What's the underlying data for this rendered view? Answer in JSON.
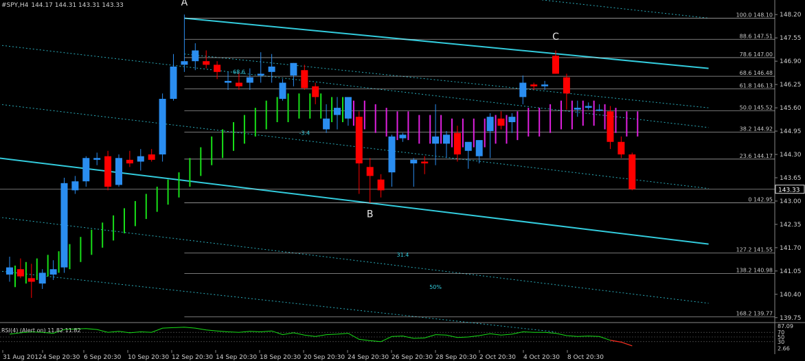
{
  "chart_data": {
    "type": "candlestick",
    "symbol_header": "#SPY,H4",
    "ohlc_header": "144.17 144.31 143.31 143.33",
    "price_axis": {
      "range": [
        139.65,
        148.3
      ],
      "ticks": [
        "148.20",
        "147.55",
        "146.90",
        "146.25",
        "145.60",
        "144.95",
        "144.30",
        "143.65",
        "143.00",
        "142.35",
        "141.70",
        "141.05",
        "140.40",
        "139.75"
      ],
      "current_price_label": "143.33",
      "current_price": 143.33
    },
    "time_axis": {
      "labels": [
        "31 Aug 2012",
        "4 Sep 20:30",
        "6 Sep 20:30",
        "10 Sep 20:30",
        "12 Sep 20:30",
        "14 Sep 20:30",
        "18 Sep 20:30",
        "20 Sep 20:30",
        "24 Sep 20:30",
        "26 Sep 20:30",
        "28 Sep 20:30",
        "2 Oct 20:30",
        "4 Oct 20:30",
        "8 Oct 20:30"
      ]
    },
    "candles": [
      {
        "o": 140.95,
        "h": 141.45,
        "l": 140.75,
        "c": 141.15
      },
      {
        "o": 141.1,
        "h": 141.4,
        "l": 140.85,
        "c": 140.9
      },
      {
        "o": 140.85,
        "h": 141.25,
        "l": 140.3,
        "c": 140.75
      },
      {
        "o": 140.7,
        "h": 141.1,
        "l": 140.55,
        "c": 141.0
      },
      {
        "o": 140.95,
        "h": 141.35,
        "l": 140.8,
        "c": 141.1
      },
      {
        "o": 141.15,
        "h": 143.65,
        "l": 141.0,
        "c": 143.5
      },
      {
        "o": 143.3,
        "h": 143.7,
        "l": 143.2,
        "c": 143.55
      },
      {
        "o": 143.55,
        "h": 144.25,
        "l": 143.4,
        "c": 144.2
      },
      {
        "o": 144.15,
        "h": 144.35,
        "l": 144.0,
        "c": 144.2
      },
      {
        "o": 144.25,
        "h": 144.4,
        "l": 143.3,
        "c": 143.4
      },
      {
        "o": 143.45,
        "h": 144.3,
        "l": 143.4,
        "c": 144.2
      },
      {
        "o": 144.15,
        "h": 144.4,
        "l": 143.95,
        "c": 144.05
      },
      {
        "o": 144.1,
        "h": 144.45,
        "l": 143.85,
        "c": 144.25
      },
      {
        "o": 144.3,
        "h": 144.45,
        "l": 144.1,
        "c": 144.15
      },
      {
        "o": 144.3,
        "h": 146.0,
        "l": 144.1,
        "c": 145.85
      },
      {
        "o": 145.85,
        "h": 147.1,
        "l": 145.8,
        "c": 146.75
      },
      {
        "o": 146.8,
        "h": 148.2,
        "l": 146.6,
        "c": 146.9
      },
      {
        "o": 146.9,
        "h": 147.4,
        "l": 146.65,
        "c": 147.2
      },
      {
        "o": 146.9,
        "h": 147.2,
        "l": 146.7,
        "c": 146.8
      },
      {
        "o": 146.8,
        "h": 146.9,
        "l": 146.4,
        "c": 146.6
      },
      {
        "o": 146.3,
        "h": 146.6,
        "l": 146.1,
        "c": 146.35
      },
      {
        "o": 146.3,
        "h": 146.6,
        "l": 146.1,
        "c": 146.2
      },
      {
        "o": 146.3,
        "h": 146.7,
        "l": 146.1,
        "c": 146.45
      },
      {
        "o": 146.5,
        "h": 147.15,
        "l": 146.3,
        "c": 146.55
      },
      {
        "o": 146.6,
        "h": 147.1,
        "l": 146.3,
        "c": 146.75
      },
      {
        "o": 145.85,
        "h": 146.4,
        "l": 145.8,
        "c": 146.3
      },
      {
        "o": 146.5,
        "h": 146.85,
        "l": 146.2,
        "c": 146.85
      },
      {
        "o": 146.65,
        "h": 146.8,
        "l": 146.1,
        "c": 146.15
      },
      {
        "o": 146.2,
        "h": 146.3,
        "l": 145.7,
        "c": 145.9
      },
      {
        "o": 145.0,
        "h": 145.7,
        "l": 144.9,
        "c": 145.3
      },
      {
        "o": 145.4,
        "h": 145.9,
        "l": 145.0,
        "c": 145.6
      },
      {
        "o": 145.3,
        "h": 145.75,
        "l": 145.1,
        "c": 145.9
      },
      {
        "o": 145.35,
        "h": 145.5,
        "l": 143.2,
        "c": 144.05
      },
      {
        "o": 143.95,
        "h": 144.2,
        "l": 142.95,
        "c": 143.7
      },
      {
        "o": 143.6,
        "h": 143.75,
        "l": 143.1,
        "c": 143.3
      },
      {
        "o": 143.8,
        "h": 144.85,
        "l": 143.4,
        "c": 144.8
      },
      {
        "o": 144.75,
        "h": 144.9,
        "l": 144.65,
        "c": 144.85
      },
      {
        "o": 144.05,
        "h": 144.2,
        "l": 143.4,
        "c": 144.15
      },
      {
        "o": 144.1,
        "h": 144.25,
        "l": 143.75,
        "c": 144.05
      },
      {
        "o": 144.6,
        "h": 145.7,
        "l": 144.0,
        "c": 144.8
      },
      {
        "o": 144.6,
        "h": 144.95,
        "l": 144.2,
        "c": 144.85
      },
      {
        "o": 144.9,
        "h": 145.1,
        "l": 144.1,
        "c": 144.3
      },
      {
        "o": 144.4,
        "h": 144.6,
        "l": 143.9,
        "c": 144.65
      },
      {
        "o": 144.25,
        "h": 144.5,
        "l": 144.05,
        "c": 144.7
      },
      {
        "o": 144.95,
        "h": 145.45,
        "l": 144.2,
        "c": 145.35
      },
      {
        "o": 145.3,
        "h": 145.5,
        "l": 145.0,
        "c": 145.1
      },
      {
        "o": 145.2,
        "h": 145.45,
        "l": 144.9,
        "c": 145.35
      },
      {
        "o": 145.9,
        "h": 146.5,
        "l": 145.7,
        "c": 146.3
      },
      {
        "o": 146.25,
        "h": 146.3,
        "l": 146.1,
        "c": 146.2
      },
      {
        "o": 146.2,
        "h": 146.35,
        "l": 146.1,
        "c": 146.25
      },
      {
        "o": 147.05,
        "h": 147.2,
        "l": 146.55,
        "c": 146.55
      },
      {
        "o": 146.45,
        "h": 146.55,
        "l": 145.55,
        "c": 146.0
      },
      {
        "o": 145.55,
        "h": 145.8,
        "l": 145.35,
        "c": 145.6
      },
      {
        "o": 145.6,
        "h": 145.75,
        "l": 145.55,
        "c": 145.65
      },
      {
        "o": 145.55,
        "h": 145.7,
        "l": 145.5,
        "c": 145.55
      },
      {
        "o": 145.5,
        "h": 145.65,
        "l": 144.45,
        "c": 144.65
      },
      {
        "o": 144.65,
        "h": 144.8,
        "l": 144.2,
        "c": 144.3
      },
      {
        "o": 144.3,
        "h": 144.35,
        "l": 143.3,
        "c": 143.33
      }
    ],
    "indicator_bars": {
      "comment": "green/magenta vertical bars (low-high) per candle",
      "green_until_index": 30,
      "bars": [
        [
          140.6,
          141.2
        ],
        [
          140.7,
          141.3
        ],
        [
          140.8,
          141.4
        ],
        [
          140.9,
          141.5
        ],
        [
          141.0,
          141.6
        ],
        [
          141.1,
          141.8
        ],
        [
          141.3,
          142.0
        ],
        [
          141.5,
          142.2
        ],
        [
          141.7,
          142.4
        ],
        [
          141.9,
          142.6
        ],
        [
          142.1,
          142.8
        ],
        [
          142.3,
          143.0
        ],
        [
          142.5,
          143.2
        ],
        [
          142.7,
          143.4
        ],
        [
          142.9,
          143.6
        ],
        [
          143.1,
          143.8
        ],
        [
          143.4,
          144.2
        ],
        [
          143.7,
          144.5
        ],
        [
          144.0,
          144.8
        ],
        [
          144.2,
          145.0
        ],
        [
          144.4,
          145.2
        ],
        [
          144.6,
          145.4
        ],
        [
          144.8,
          145.6
        ],
        [
          145.0,
          145.8
        ],
        [
          145.2,
          145.9
        ],
        [
          145.2,
          146.0
        ],
        [
          145.3,
          146.0
        ],
        [
          145.3,
          146.0
        ],
        [
          145.3,
          146.0
        ],
        [
          145.2,
          145.9
        ],
        [
          145.2,
          145.9
        ],
        [
          145.1,
          145.8
        ],
        [
          145.0,
          145.8
        ],
        [
          144.9,
          145.7
        ],
        [
          144.8,
          145.6
        ],
        [
          144.7,
          145.5
        ],
        [
          144.7,
          145.5
        ],
        [
          144.6,
          145.4
        ],
        [
          144.6,
          145.4
        ],
        [
          144.6,
          145.4
        ],
        [
          144.5,
          145.3
        ],
        [
          144.5,
          145.3
        ],
        [
          144.5,
          145.3
        ],
        [
          144.5,
          145.3
        ],
        [
          144.6,
          145.4
        ],
        [
          144.6,
          145.4
        ],
        [
          144.7,
          145.5
        ],
        [
          144.8,
          145.6
        ],
        [
          144.8,
          145.6
        ],
        [
          144.9,
          145.7
        ],
        [
          145.0,
          145.8
        ],
        [
          145.0,
          145.8
        ],
        [
          145.1,
          145.8
        ],
        [
          145.1,
          145.8
        ],
        [
          145.0,
          145.7
        ],
        [
          144.9,
          145.6
        ],
        [
          144.8,
          145.5
        ],
        [
          144.8,
          145.5
        ]
      ],
      "colors": {
        "up": "#18e018",
        "down": "#e020e0"
      }
    },
    "fib_levels": [
      {
        "label": "100.0 148.10",
        "price": 148.1
      },
      {
        "label": "88.6 147.51",
        "price": 147.51
      },
      {
        "label": "78.6 147.00",
        "price": 147.0
      },
      {
        "label": "68.6 146.48",
        "price": 146.48
      },
      {
        "label": "61.8 146.13",
        "price": 146.13
      },
      {
        "label": "50.0 145.52",
        "price": 145.52
      },
      {
        "label": "38.2 144.92",
        "price": 144.92
      },
      {
        "label": "23.6 144.17",
        "price": 144.17
      },
      {
        "label": "0 142.95",
        "price": 142.95
      },
      {
        "label": "127.2 141.55",
        "price": 141.55
      },
      {
        "label": "138.2 140.98",
        "price": 140.98
      },
      {
        "label": "168.2 139.77",
        "price": 139.77
      }
    ],
    "wave_labels": [
      {
        "text": "A",
        "candle": 16,
        "price": 148.45
      },
      {
        "text": "B",
        "candle": 33,
        "price": 142.55
      },
      {
        "text": "C",
        "candle": 50,
        "price": 147.5
      }
    ],
    "channel_lines": [
      {
        "from": [
          16,
          148.1
        ],
        "to": [
          64,
          146.7
        ],
        "style": "solid",
        "width": 2
      },
      {
        "from": [
          -1,
          144.2
        ],
        "to": [
          64,
          141.8
        ],
        "style": "solid",
        "width": 2
      },
      {
        "from": [
          -1,
          147.35
        ],
        "to": [
          64,
          145.05
        ],
        "style": "dotted"
      },
      {
        "from": [
          -1,
          145.7
        ],
        "to": [
          64,
          143.35
        ],
        "style": "dotted"
      },
      {
        "from": [
          -1,
          142.55
        ],
        "to": [
          64,
          140.15
        ],
        "style": "dotted"
      },
      {
        "from": [
          -1,
          141.05
        ],
        "to": [
          50,
          139.35
        ],
        "style": "dotted"
      },
      {
        "from": [
          40,
          148.9
        ],
        "to": [
          64,
          148.1
        ],
        "style": "dotted"
      },
      {
        "from": [
          16,
          147.1
        ],
        "to": [
          64,
          145.6
        ],
        "style": "dotted"
      }
    ],
    "inline_labels": [
      {
        "text": "68.6",
        "candle": 21,
        "price": 146.55
      },
      {
        "text": "-3.4",
        "candle": 27,
        "price": 144.85
      },
      {
        "text": "31.4",
        "candle": 36,
        "price": 141.45
      },
      {
        "text": "50%",
        "candle": 39,
        "price": 140.55
      }
    ],
    "colors": {
      "bull": "#2a8df0",
      "bear": "#ff0000",
      "channel": "#33ccdd",
      "fib": "#d8d8d8",
      "text": "#c8c8c8",
      "background": "#000000",
      "rsi": "#18e018"
    },
    "rsi": {
      "label": "RSI(4) (Alert on) 11.82 11.82",
      "ticks": [
        "87.09",
        "70",
        "50",
        "30",
        "2.66"
      ],
      "values": [
        62,
        68,
        72,
        70,
        66,
        82,
        84,
        86,
        82,
        70,
        74,
        68,
        72,
        70,
        88,
        90,
        92,
        88,
        80,
        76,
        72,
        70,
        74,
        72,
        76,
        60,
        68,
        58,
        52,
        60,
        62,
        66,
        40,
        34,
        30,
        52,
        54,
        44,
        46,
        60,
        58,
        48,
        50,
        56,
        64,
        58,
        62,
        72,
        70,
        70,
        66,
        56,
        52,
        54,
        52,
        36,
        28,
        12
      ]
    }
  }
}
